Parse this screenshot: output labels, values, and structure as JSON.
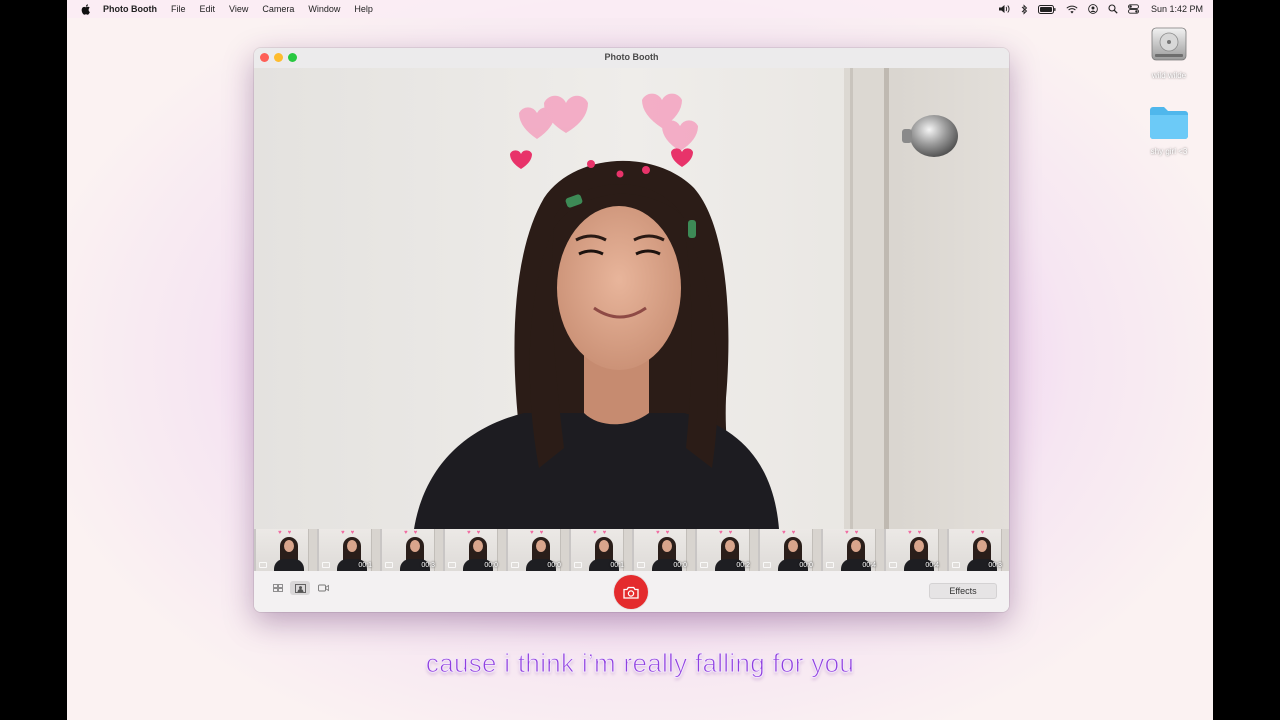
{
  "menubar": {
    "app_name": "Photo Booth",
    "menus": [
      "File",
      "Edit",
      "View",
      "Camera",
      "Window",
      "Help"
    ],
    "clock": "Sun 1:42 PM",
    "status_icons": [
      "volume-icon",
      "bluetooth-icon",
      "battery-icon",
      "wifi-icon",
      "user-icon",
      "spotlight-icon",
      "control-center-icon"
    ]
  },
  "desktop": {
    "icons": [
      {
        "label": "wild wilde",
        "icon": "hard-drive-icon"
      },
      {
        "label": "shy girl <3",
        "icon": "folder-icon"
      }
    ]
  },
  "window": {
    "title": "Photo Booth",
    "filmstrip": [
      {
        "duration": ""
      },
      {
        "duration": "00:1"
      },
      {
        "duration": "00:3"
      },
      {
        "duration": "00:0"
      },
      {
        "duration": "00:0"
      },
      {
        "duration": "00:1"
      },
      {
        "duration": "00:0"
      },
      {
        "duration": "00:2"
      },
      {
        "duration": "00:0"
      },
      {
        "duration": "00:4"
      },
      {
        "duration": "00:4"
      },
      {
        "duration": "00:3"
      }
    ],
    "toolbar": {
      "effects_label": "Effects",
      "view_modes": [
        "grid-view-icon",
        "single-photo-icon",
        "video-icon"
      ]
    }
  },
  "caption": "cause i think i’m really falling for you",
  "colors": {
    "shutter": "#e42b2d",
    "caption": "#8e3fe0",
    "hearts": "#f4a3c0"
  }
}
